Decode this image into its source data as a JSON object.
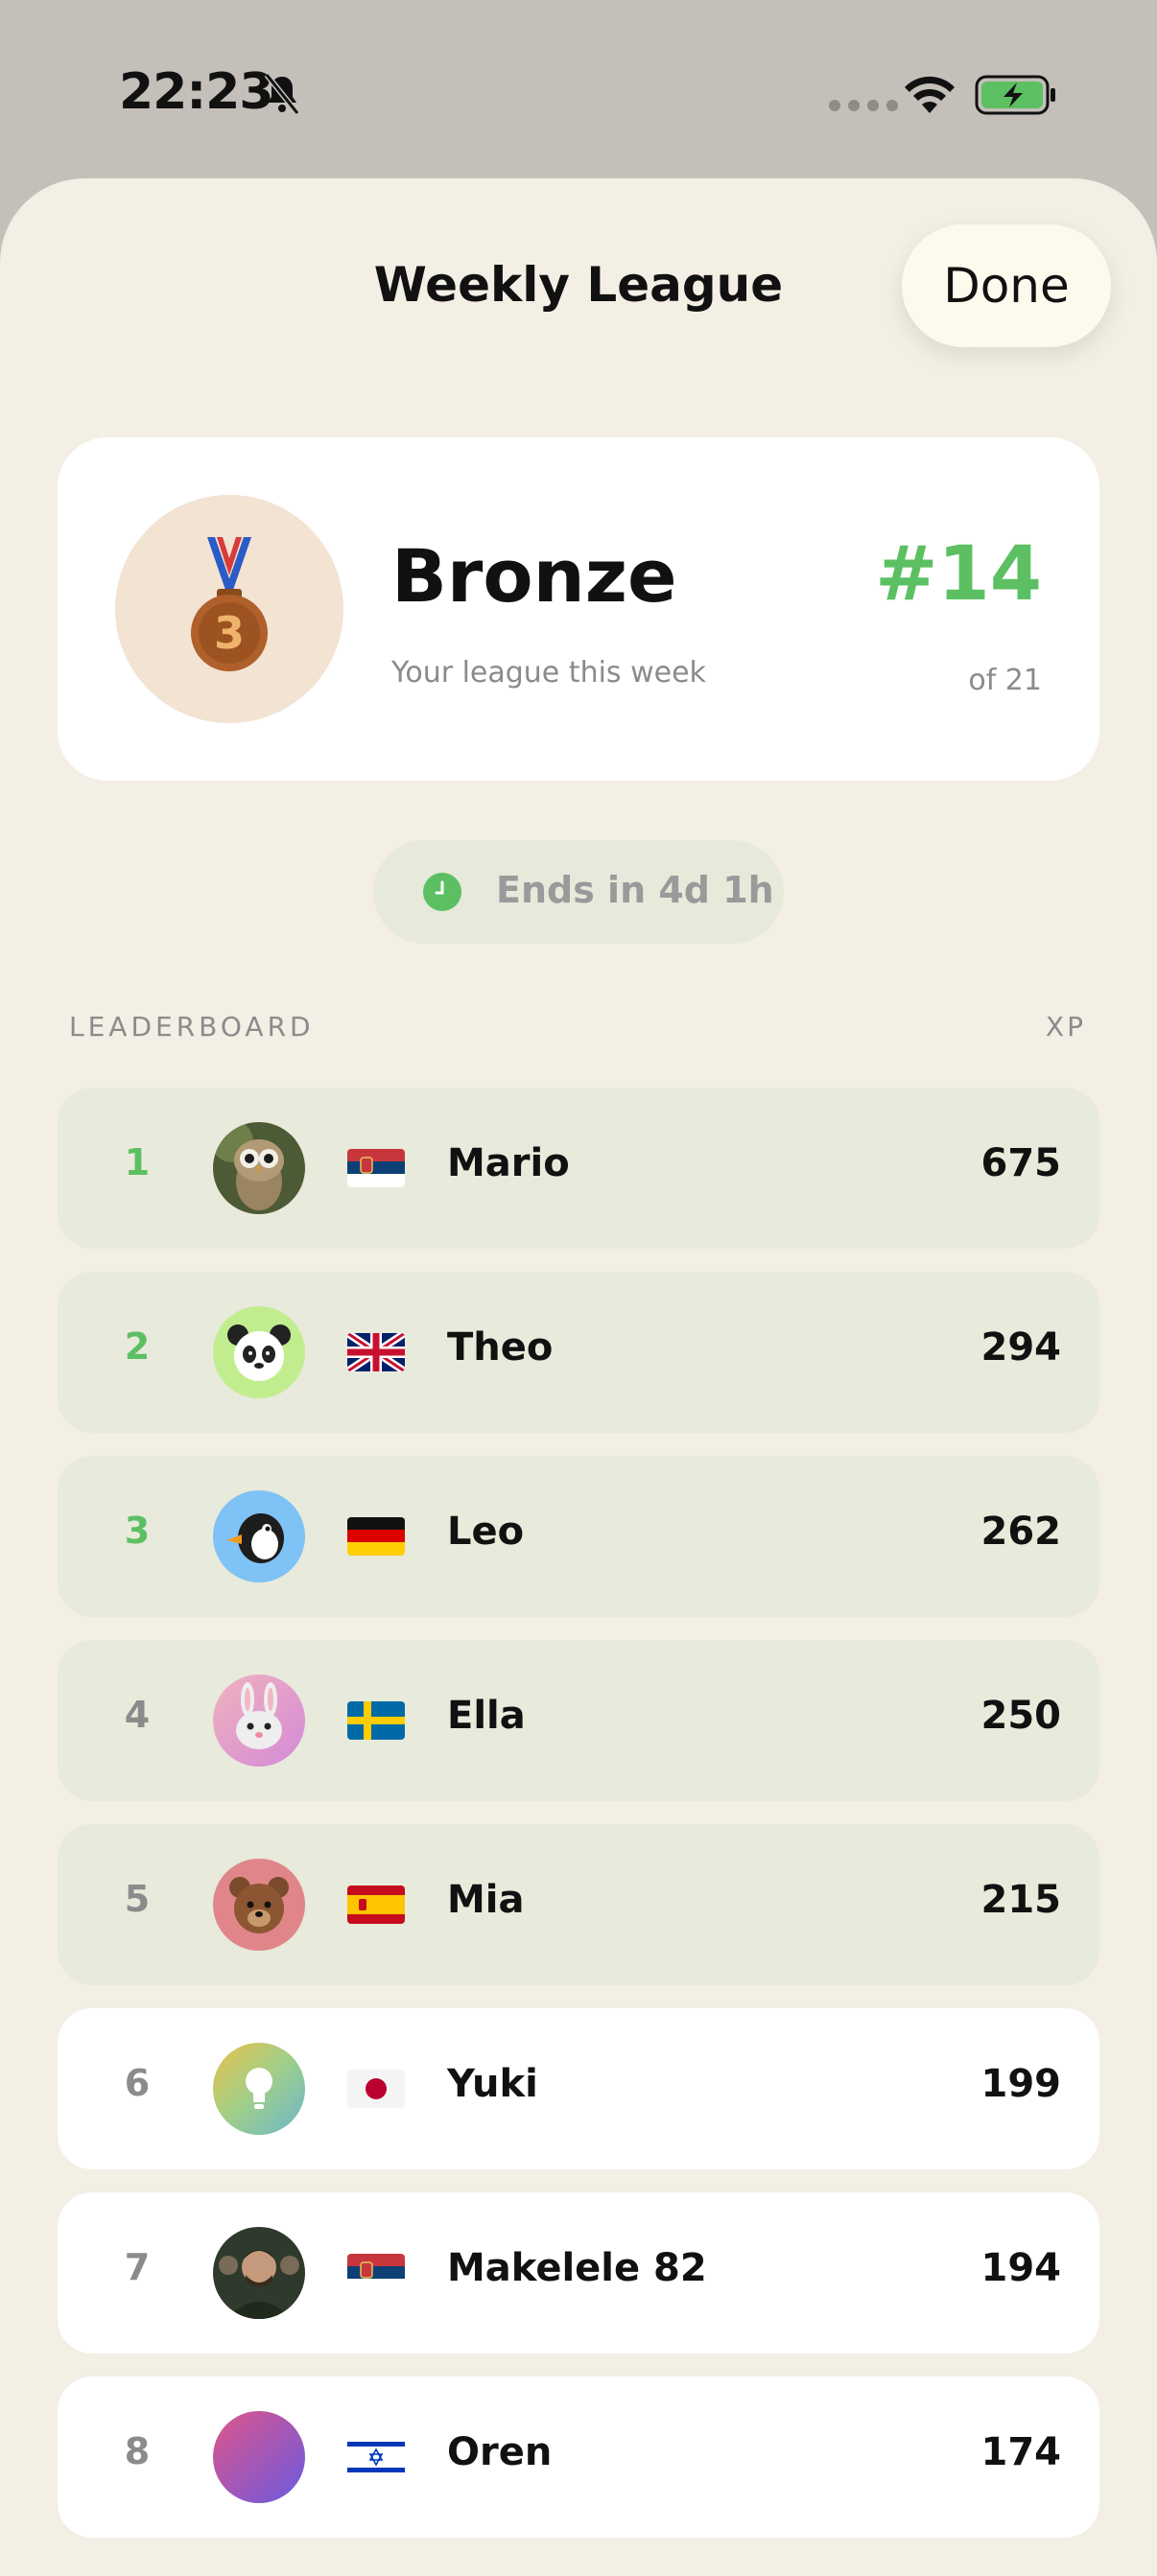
{
  "status_bar": {
    "time": "22:23",
    "icons": [
      "bell-muted-icon",
      "cellular-dots-icon",
      "wifi-icon",
      "battery-charging-icon"
    ]
  },
  "sheet": {
    "title": "Weekly League",
    "done_label": "Done"
  },
  "league": {
    "name": "Bronze",
    "subtitle": "Your league this week",
    "rank": "#14",
    "rank_of": "of 21",
    "medal_number": "3",
    "colors": {
      "rank": "#5cc063",
      "medal": "#b0602a"
    }
  },
  "timer": {
    "label": "Ends in 4d 1h",
    "icon": "clock-icon"
  },
  "leaderboard": {
    "label": "LEADERBOARD",
    "xp_label": "XP",
    "rows": [
      {
        "pos": "1",
        "name": "Mario",
        "xp": "675",
        "flag": "serbia",
        "avatar": "owl"
      },
      {
        "pos": "2",
        "name": "Theo",
        "xp": "294",
        "flag": "uk",
        "avatar": "panda"
      },
      {
        "pos": "3",
        "name": "Leo",
        "xp": "262",
        "flag": "germany",
        "avatar": "penguin"
      },
      {
        "pos": "4",
        "name": "Ella",
        "xp": "250",
        "flag": "sweden",
        "avatar": "rabbit"
      },
      {
        "pos": "5",
        "name": "Mia",
        "xp": "215",
        "flag": "spain",
        "avatar": "bear"
      },
      {
        "pos": "6",
        "name": "Yuki",
        "xp": "199",
        "flag": "japan",
        "avatar": "lightbulb"
      },
      {
        "pos": "7",
        "name": "Makelele 82",
        "xp": "194",
        "flag": "serbia",
        "avatar": "photo"
      },
      {
        "pos": "8",
        "name": "Oren",
        "xp": "174",
        "flag": "israel",
        "avatar": "gradient"
      }
    ]
  }
}
